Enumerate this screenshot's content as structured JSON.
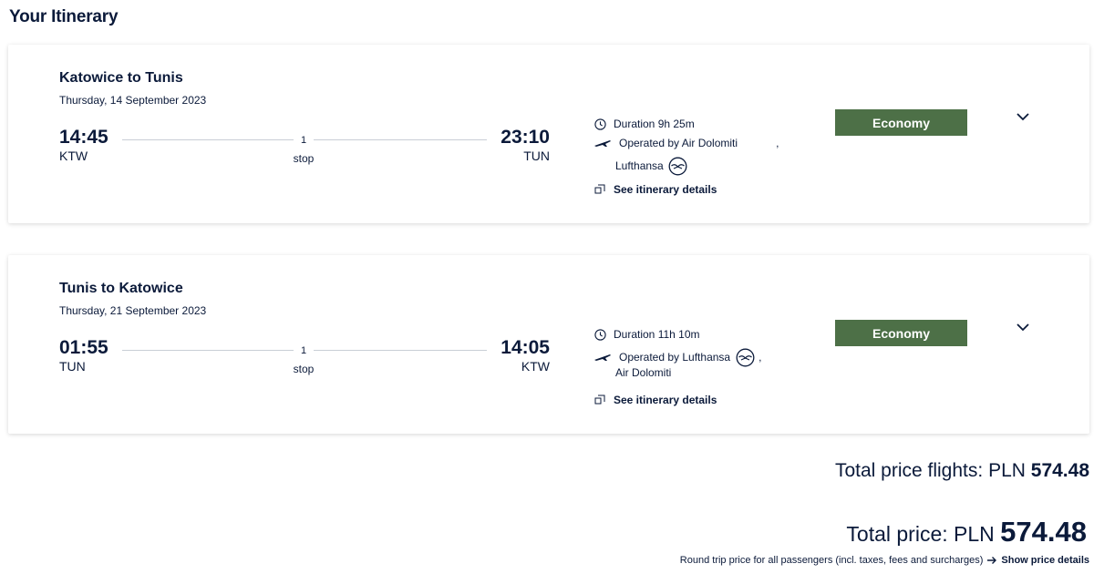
{
  "page": {
    "title": "Your Itinerary"
  },
  "flights": [
    {
      "route": "Katowice to Tunis",
      "date": "Thursday, 14 September 2023",
      "departure": {
        "time": "14:45",
        "code": "KTW"
      },
      "arrival": {
        "time": "23:10",
        "code": "TUN"
      },
      "stops": {
        "count": "1",
        "label": "stop"
      },
      "duration": "Duration 9h 25m",
      "operated_prefix": "Operated by Air Dolomiti",
      "operated_comma": ",",
      "operated_second": "Lufthansa",
      "details_link": "See itinerary details",
      "fare": "Economy"
    },
    {
      "route": "Tunis to Katowice",
      "date": "Thursday, 21 September 2023",
      "departure": {
        "time": "01:55",
        "code": "TUN"
      },
      "arrival": {
        "time": "14:05",
        "code": "KTW"
      },
      "stops": {
        "count": "1",
        "label": "stop"
      },
      "duration": "Duration 11h 10m",
      "operated_prefix": "Operated by Lufthansa",
      "operated_comma": ",",
      "operated_second": "Air Dolomiti",
      "details_link": "See itinerary details",
      "fare": "Economy"
    }
  ],
  "totals": {
    "flights_label": "Total price flights:",
    "flights_currency": "PLN",
    "flights_amount": "574.48",
    "total_label": "Total price:",
    "total_currency": "PLN",
    "total_amount": "574.48",
    "footnote": "Round trip price for all passengers (incl. taxes, fees and surcharges)",
    "show_details": "Show price details"
  },
  "colors": {
    "navy": "#0b1a3a",
    "fare_green": "#4d7047",
    "line_gray": "#c9ced6"
  },
  "icons": [
    "clock-icon",
    "airplane-icon",
    "lufthansa-logo-icon",
    "external-link-icon",
    "chevron-down-icon",
    "arrow-right-icon"
  ]
}
